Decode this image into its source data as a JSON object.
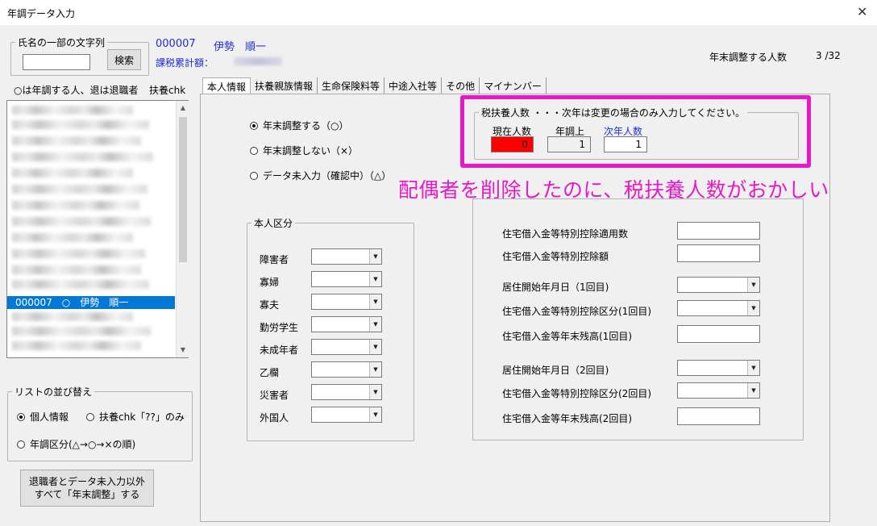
{
  "window": {
    "title": "年調データ入力",
    "close_icon": "✕"
  },
  "search": {
    "legend": "氏名の一部の文字列",
    "value": "",
    "button": "検索"
  },
  "employee": {
    "code": "000007",
    "name": "伊勢　順一",
    "tax_total_label": "課税累計額："
  },
  "header_right": {
    "label": "年末調整する人数",
    "count": "3 /32"
  },
  "list": {
    "header_left": "○は年調する人、退は退職者",
    "header_right": "扶養chk",
    "selected_row": "000007　○　伊勢　順一",
    "scroll_up": "▲",
    "scroll_down": "▼"
  },
  "sort": {
    "legend": "リストの並び替え",
    "options": [
      "個人情報",
      "扶養chk「??」のみ",
      "年調区分(△→○→×の順)"
    ],
    "selected": 0
  },
  "bottom_button": {
    "line1": "退職者とデータ未入力以外",
    "line2": "すべて「年末調整」する"
  },
  "tabs": [
    "本人情報",
    "扶養親族情報",
    "生命保険料等",
    "中途入社等",
    "その他",
    "マイナンバー"
  ],
  "active_tab": 0,
  "year_end": {
    "options": [
      "年末調整する（○）",
      "年末調整しない（×）",
      "データ未入力（確認中）（△）"
    ],
    "selected": 0
  },
  "dependents": {
    "legend": "税扶養人数 ・・・次年は変更の場合のみ入力してください。",
    "current_label": "現在人数",
    "current_value": "0",
    "year_adj_label": "年調上",
    "year_adj_value": "1",
    "next_label": "次年人数",
    "next_value": "1",
    "current_color": "#ff0000"
  },
  "annotation": "配偶者を削除したのに、税扶養人数がおかしい",
  "annotation_color": "#e619c8",
  "personal": {
    "legend": "本人区分",
    "items": [
      "障害者",
      "寡婦",
      "寡夫",
      "勤労学生",
      "未成年者",
      "乙欄",
      "災害者",
      "外国人"
    ]
  },
  "housing": {
    "items": [
      "住宅借入金等特別控除適用数",
      "住宅借入金等特別控除額",
      "居住開始年月日（1回目)",
      "住宅借入金等特別控除区分(1回目)",
      "住宅借入金等年末残高(1回目)",
      "居住開始年月日（2回目)",
      "住宅借入金等特別控除区分(2回目)",
      "住宅借入金等年末残高(2回目)"
    ]
  }
}
